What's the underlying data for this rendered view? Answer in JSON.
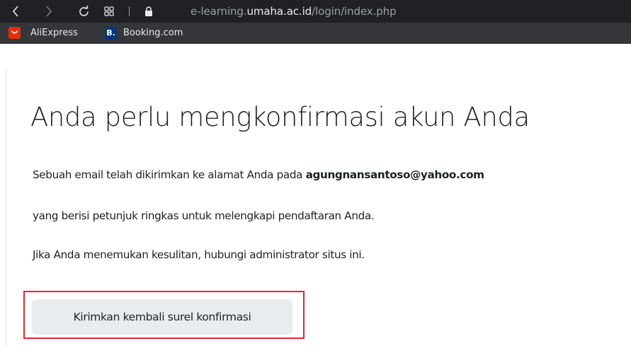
{
  "browser": {
    "url_prefix": "e-learning.",
    "url_host": "umaha.ac.id",
    "url_path": "/login/index.php",
    "bookmarks": [
      {
        "label": "AliExpress",
        "icon": "aliexpress-icon",
        "color": "#e62e04"
      },
      {
        "label": "Booking.com",
        "icon": "booking-icon",
        "icon_text": "B.",
        "color": "#003580"
      }
    ]
  },
  "page": {
    "title": "Anda perlu mengkonfirmasi akun Anda",
    "line1_prefix": "Sebuah email telah dikirimkan ke alamat Anda pada ",
    "email": "agungnansantoso@yahoo.com",
    "line2": "yang berisi petunjuk ringkas untuk melengkapi pendaftaran Anda.",
    "line3": "Jika Anda menemukan kesulitan, hubungi administrator situs ini.",
    "resend_button": "Kirimkan kembali surel konfirmasi"
  },
  "colors": {
    "browser_bg": "#202124",
    "highlight_border": "#e3262f",
    "button_bg": "#e9ecef",
    "text": "#1d2125"
  }
}
